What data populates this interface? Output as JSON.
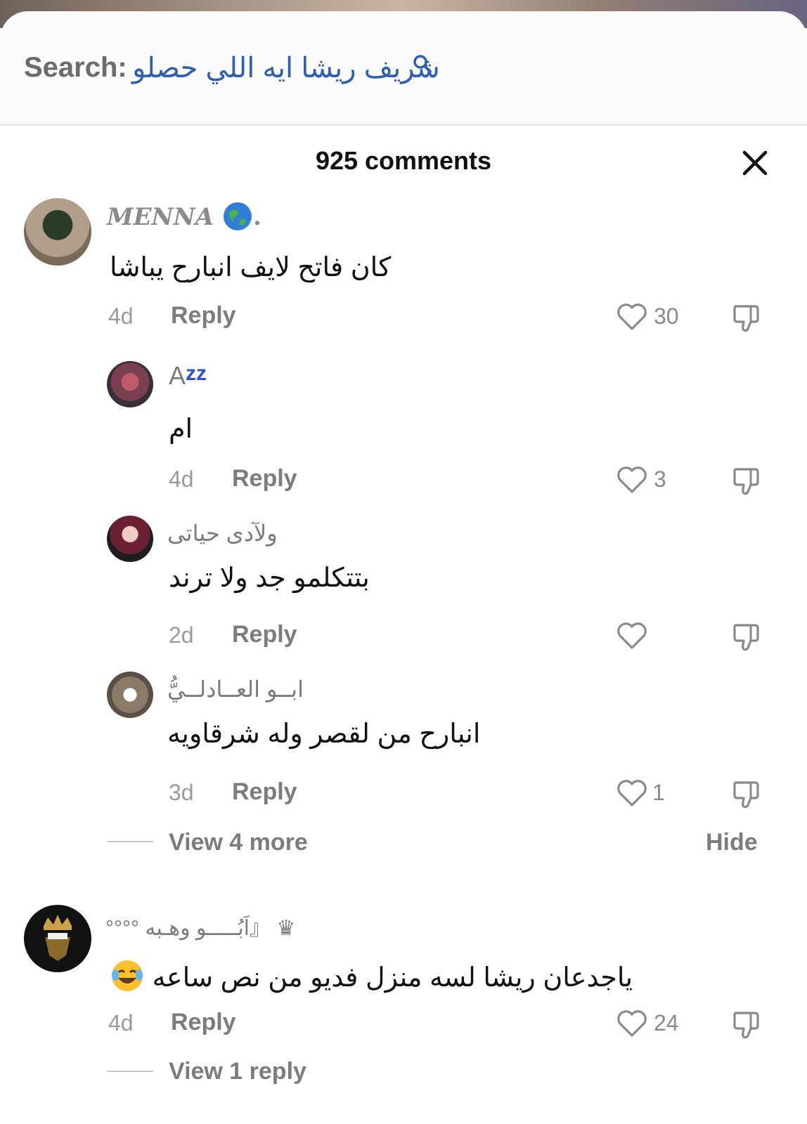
{
  "search": {
    "label": "Search:",
    "query": "شريف ريشا ايه اللي حصلو"
  },
  "header": {
    "title": "925 comments"
  },
  "comments": [
    {
      "username": "MENNA",
      "text": "كان فاتح لايف انبارح يباشا",
      "time": "4d",
      "reply": "Reply",
      "likes": "30"
    },
    {
      "username": "A",
      "username_suffix": "zz",
      "text": "ام",
      "time": "4d",
      "reply": "Reply",
      "likes": "3"
    },
    {
      "username": "ولآدى حياتى",
      "text": "بتتكلمو جد ولا ترند",
      "time": "2d",
      "reply": "Reply",
      "likes": ""
    },
    {
      "username": "ابــو العــادلــيُّ",
      "text": "انبارح من لقصر وله شرقاويه",
      "time": "3d",
      "reply": "Reply",
      "likes": "1"
    },
    {
      "username": "♛ 『اَبُـــــو وهـبه °°°°",
      "text": "ياجدعان ريشا لسه منزل فديو من نص ساعه",
      "time": "4d",
      "reply": "Reply",
      "likes": "24"
    }
  ],
  "thread": {
    "view_more": "View 4 more",
    "hide": "Hide",
    "view_reply": "View 1 reply"
  },
  "colors": {
    "query_blue": "#2e5fae",
    "muted": "#7c7c7c"
  }
}
